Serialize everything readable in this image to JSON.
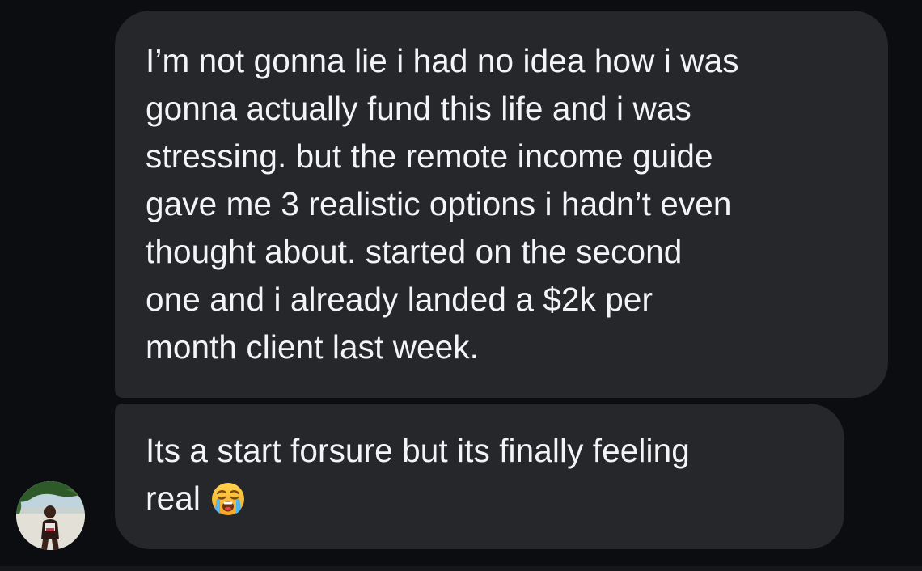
{
  "messages": [
    {
      "lines": [
        "I’m not gonna lie i had no idea how i was",
        "gonna actually fund this life and i was",
        "stressing. but the remote income guide",
        "gave me 3 realistic options i hadn’t even",
        "thought about. started on the second",
        "one and i already landed a $2k per",
        "month client last week."
      ]
    },
    {
      "lines": [
        "Its a start forsure but its finally feeling",
        "real"
      ],
      "emoji": "loudly-crying-face"
    }
  ],
  "avatar": {
    "icon": "avatar"
  },
  "colors": {
    "background": "#0c0d11",
    "bubble": "#26272b",
    "text": "#f4f4f6"
  }
}
